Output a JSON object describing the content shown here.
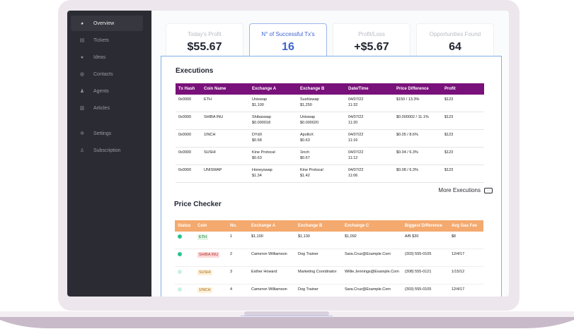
{
  "sidebar": {
    "items": [
      {
        "label": "Overview",
        "icon": "pie-chart-icon",
        "active": true
      },
      {
        "label": "Tickets",
        "icon": "ticket-icon",
        "active": false
      },
      {
        "label": "Ideas",
        "icon": "lightbulb-icon",
        "active": false
      },
      {
        "label": "Contacts",
        "icon": "contacts-icon",
        "active": false
      },
      {
        "label": "Agents",
        "icon": "user-icon",
        "active": false
      },
      {
        "label": "Articles",
        "icon": "book-icon",
        "active": false
      },
      {
        "label": "Settings",
        "icon": "gear-icon",
        "active": false
      },
      {
        "label": "Subscription",
        "icon": "shield-icon",
        "active": false
      }
    ]
  },
  "stats": [
    {
      "label": "Today's Profit",
      "value": "$55.67"
    },
    {
      "label": "N° of Successful Tx's",
      "value": "16"
    },
    {
      "label": "Profit/Loss",
      "value": "+$5.67"
    },
    {
      "label": "Opportunities Found",
      "value": "64"
    }
  ],
  "executions": {
    "title": "Executions",
    "columns": [
      "Tx Hash",
      "Coin Name",
      "Exchange A",
      "Exchange B",
      "Date/Time",
      "Price Difference",
      "Profit"
    ],
    "rows": [
      {
        "hash": "0x0000",
        "coin": "ETH",
        "ex_a": "Uniswap",
        "ex_a_price": "$1,100",
        "ex_b": "Sushiswap",
        "ex_b_price": "$1,250",
        "date": "04/07/22",
        "time": "11:32",
        "diff": "$150 / 13.3%",
        "profit": "$123"
      },
      {
        "hash": "0x0000",
        "coin": "SHIBA INU",
        "ex_a": "Shibaswap",
        "ex_a_price": "$0.000018",
        "ex_b": "Uniswap",
        "ex_b_price": "$0.000020",
        "date": "04/07/22",
        "time": "11:20",
        "diff": "$0.000002 / 11.1%",
        "profit": "$123"
      },
      {
        "hash": "0x0000",
        "coin": "1INCH",
        "ex_a": "DYdX",
        "ex_a_price": "$0.58",
        "ex_b": "ApolloX",
        "ex_b_price": "$0.63",
        "date": "04/07/22",
        "time": "11:16",
        "diff": "$0.05 / 8.6%",
        "profit": "$123"
      },
      {
        "hash": "0x0000",
        "coin": "SUSHI",
        "ex_a": "Kine Protocal",
        "ex_a_price": "$0.63",
        "ex_b": "1inch",
        "ex_b_price": "$0.67",
        "date": "04/07/22",
        "time": "11:12",
        "diff": "$0.04 / 6.3%",
        "profit": "$123"
      },
      {
        "hash": "0x0000",
        "coin": "UNISWAP",
        "ex_a": "Honeyswap",
        "ex_a_price": "$1.34",
        "ex_b": "Kine Protocal",
        "ex_b_price": "$1.42",
        "date": "04/07/22",
        "time": "11:06",
        "diff": "$0.08 / 6.3%",
        "profit": "$123"
      }
    ],
    "more_label": "More Executions"
  },
  "price_checker": {
    "title": "Price Checker",
    "columns": [
      "Status",
      "Coin",
      "No.",
      "Exchange A",
      "Exchange B",
      "Exchange C",
      "Biggest Difference",
      "Avg Gas Fee"
    ],
    "rows": [
      {
        "status_color": "#29c48d",
        "coin": "ETH",
        "coin_bg": "#dff5e3",
        "coin_color": "#1e7a3d",
        "no": "1",
        "ex_a": "$1,100",
        "ex_b": "$1,130",
        "ex_c": "$1,092",
        "diff": "A/B $30",
        "fee": "$8"
      },
      {
        "status_color": "#29c48d",
        "coin": "SHIBA INU",
        "coin_bg": "#fbd9d9",
        "coin_color": "#b8302e",
        "no": "2",
        "ex_a": "Cameron Williamson",
        "ex_b": "Dog Trainer",
        "ex_c": "Sara.Cruz@Example.Com",
        "diff": "(303) 555-0105",
        "fee": "12/4/17"
      },
      {
        "status_color": "#c9f0e6",
        "coin": "SUSHI",
        "coin_bg": "#fdf0d6",
        "coin_color": "#a1661a",
        "no": "3",
        "ex_a": "Esther Howard",
        "ex_b": "Marketing Coordinator",
        "ex_c": "Willie.Jennings@Example.Com",
        "diff": "(308) 555-0121",
        "fee": "1/15/12"
      },
      {
        "status_color": "#c9f0e6",
        "coin": "1INCH",
        "coin_bg": "#fdf0d6",
        "coin_color": "#a1661a",
        "no": "4",
        "ex_a": "Cameron Williamson",
        "ex_b": "Dog Trainer",
        "ex_c": "Sara.Cruz@Example.Com",
        "diff": "(303) 555-0105",
        "fee": "12/4/17"
      }
    ]
  }
}
